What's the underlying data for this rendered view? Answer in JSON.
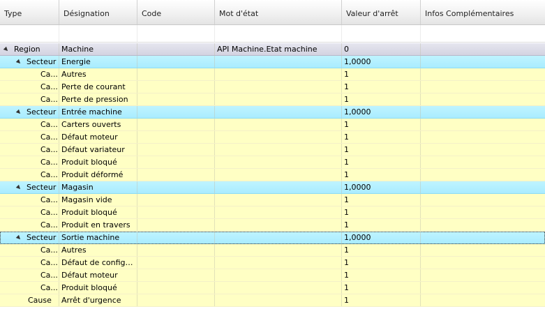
{
  "columns": [
    "Type",
    "Désignation",
    "Code",
    "Mot d'état",
    "Valeur d'arrêt",
    "Infos Complémentaires"
  ],
  "rows": [
    {
      "kind": "region",
      "type": "Region",
      "designation": "Machine",
      "code": "",
      "mot": "API Machine.Etat machine",
      "valeur": "0",
      "infos": ""
    },
    {
      "kind": "secteur",
      "type": "Secteur",
      "designation": "Energie",
      "code": "",
      "mot": "",
      "valeur": "1,0000",
      "infos": ""
    },
    {
      "kind": "cause",
      "type": "Ca...",
      "designation": "Autres",
      "code": "",
      "mot": "",
      "valeur": "1",
      "infos": ""
    },
    {
      "kind": "cause",
      "type": "Ca...",
      "designation": "Perte de courant",
      "code": "",
      "mot": "",
      "valeur": "1",
      "infos": ""
    },
    {
      "kind": "cause",
      "type": "Ca...",
      "designation": "Perte de pression",
      "code": "",
      "mot": "",
      "valeur": "1",
      "infos": ""
    },
    {
      "kind": "secteur",
      "type": "Secteur",
      "designation": "Entrée machine",
      "code": "",
      "mot": "",
      "valeur": "1,0000",
      "infos": ""
    },
    {
      "kind": "cause",
      "type": "Ca...",
      "designation": "Carters ouverts",
      "code": "",
      "mot": "",
      "valeur": "1",
      "infos": ""
    },
    {
      "kind": "cause",
      "type": "Ca...",
      "designation": "Défaut moteur",
      "code": "",
      "mot": "",
      "valeur": "1",
      "infos": ""
    },
    {
      "kind": "cause",
      "type": "Ca...",
      "designation": "Défaut variateur",
      "code": "",
      "mot": "",
      "valeur": "1",
      "infos": ""
    },
    {
      "kind": "cause",
      "type": "Ca...",
      "designation": "Produit bloqué",
      "code": "",
      "mot": "",
      "valeur": "1",
      "infos": ""
    },
    {
      "kind": "cause",
      "type": "Ca...",
      "designation": "Produit déformé",
      "code": "",
      "mot": "",
      "valeur": "1",
      "infos": ""
    },
    {
      "kind": "secteur",
      "type": "Secteur",
      "designation": "Magasin",
      "code": "",
      "mot": "",
      "valeur": "1,0000",
      "infos": ""
    },
    {
      "kind": "cause",
      "type": "Ca...",
      "designation": "Magasin vide",
      "code": "",
      "mot": "",
      "valeur": "1",
      "infos": ""
    },
    {
      "kind": "cause",
      "type": "Ca...",
      "designation": "Produit bloqué",
      "code": "",
      "mot": "",
      "valeur": "1",
      "infos": ""
    },
    {
      "kind": "cause",
      "type": "Ca...",
      "designation": "Produit en travers",
      "code": "",
      "mot": "",
      "valeur": "1",
      "infos": ""
    },
    {
      "kind": "secteur",
      "type": "Secteur",
      "designation": "Sortie machine",
      "code": "",
      "mot": "",
      "valeur": "1,0000",
      "infos": "",
      "selected": true
    },
    {
      "kind": "cause",
      "type": "Ca...",
      "designation": "Autres",
      "code": "",
      "mot": "",
      "valeur": "1",
      "infos": ""
    },
    {
      "kind": "cause",
      "type": "Ca...",
      "designation": "Défaut de configur...",
      "code": "",
      "mot": "",
      "valeur": "1",
      "infos": ""
    },
    {
      "kind": "cause",
      "type": "Ca...",
      "designation": "Défaut moteur",
      "code": "",
      "mot": "",
      "valeur": "1",
      "infos": ""
    },
    {
      "kind": "cause",
      "type": "Ca...",
      "designation": "Produit bloqué",
      "code": "",
      "mot": "",
      "valeur": "1",
      "infos": ""
    },
    {
      "kind": "cause-deep",
      "type": "Cause",
      "designation": "Arrêt d'urgence",
      "code": "",
      "mot": "",
      "valeur": "1",
      "infos": ""
    }
  ],
  "icons": {
    "expand": "expanded-triangle-icon"
  },
  "colors": {
    "cause_row": "#ffffc4",
    "secteur_row": "#b4f0ff",
    "region_row": "#dcdce8"
  }
}
